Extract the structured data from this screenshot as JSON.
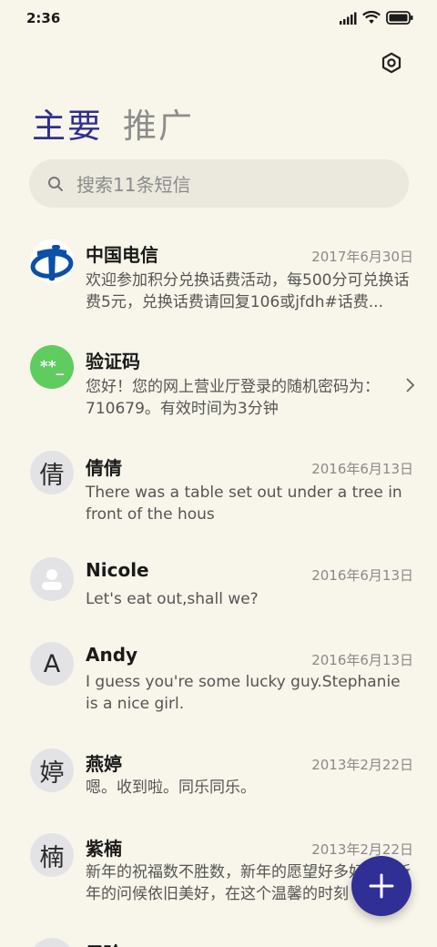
{
  "status_bar": {
    "time": "2:36"
  },
  "tabs": [
    {
      "label": "主要",
      "active": true
    },
    {
      "label": "推广",
      "active": false
    }
  ],
  "search": {
    "placeholder": "搜索11条短信"
  },
  "conversations": [
    {
      "sender": "中国电信",
      "date": "2017年6月30日",
      "preview": "欢迎参加积分兑换话费活动，每500分可兑换话费5元，兑换话费请回复106或jfdh#话费...",
      "avatar": "china-telecom-logo"
    },
    {
      "sender": "验证码",
      "date": "",
      "preview": "您好！您的网上营业厅登录的随机密码为：710679。有效时间为3分钟",
      "avatar_text": "**_"
    },
    {
      "sender": "倩倩",
      "date": "2016年6月13日",
      "preview": "There was a table set out under a tree in front of the hous",
      "avatar_text": "倩"
    },
    {
      "sender": "Nicole",
      "date": "2016年6月13日",
      "preview": "Let's eat out,shall we?",
      "avatar": "person-icon"
    },
    {
      "sender": "Andy",
      "date": "2016年6月13日",
      "preview": "I guess you're some lucky guy.Stephanie is a nice girl.",
      "avatar_text": "A"
    },
    {
      "sender": "燕婷",
      "date": "2013年2月22日",
      "preview": "嗯。收到啦。同乐同乐。",
      "avatar_text": "婷"
    },
    {
      "sender": "紫楠",
      "date": "2013年2月22日",
      "preview": "新年的祝福数不胜数，新年的愿望好多好多，新年的问候依旧美好，在这个温馨的时刻",
      "avatar_text": "楠"
    },
    {
      "sender": "子玲",
      "date": "",
      "preview": "",
      "avatar_text": ""
    }
  ],
  "colors": {
    "accent": "#2f2f96",
    "background": "#f8f5ea",
    "otp_avatar": "#5fcc5f"
  }
}
